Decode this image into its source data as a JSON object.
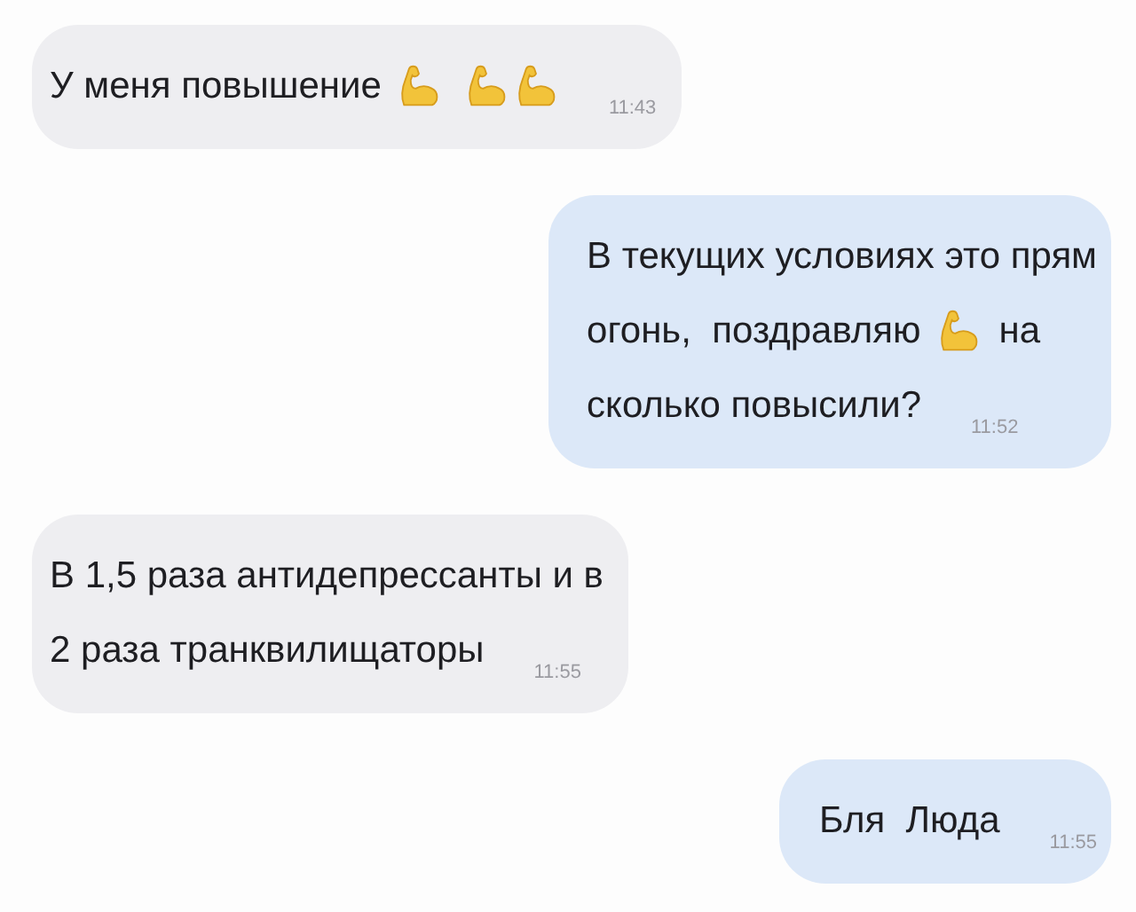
{
  "messages": [
    {
      "kind": "incoming",
      "lines": [
        [
          {
            "kind": "text",
            "text": "У меня повышение"
          },
          {
            "kind": "biceps"
          },
          {
            "kind": "biceps"
          },
          {
            "kind": "biceps"
          }
        ]
      ],
      "time": "11:43"
    },
    {
      "kind": "outgoing",
      "lines": [
        [
          {
            "kind": "text",
            "text": "В текущих условиях это прям"
          }
        ],
        [
          {
            "kind": "text",
            "text": "огонь,  поздравляю"
          },
          {
            "kind": "biceps"
          },
          {
            "kind": "text",
            "text": "на"
          }
        ],
        [
          {
            "kind": "text",
            "text": "сколько повысили?"
          }
        ]
      ],
      "time": "11:52"
    },
    {
      "kind": "incoming",
      "lines": [
        [
          {
            "kind": "text",
            "text": "В 1,5 раза антидепрессанты и в"
          }
        ],
        [
          {
            "kind": "text",
            "text": "2 раза транквилищаторы"
          }
        ]
      ],
      "time": "11:55"
    },
    {
      "kind": "outgoing",
      "lines": [
        [
          {
            "kind": "text",
            "text": "Бля  Люда"
          }
        ]
      ],
      "time": "11:55"
    }
  ]
}
